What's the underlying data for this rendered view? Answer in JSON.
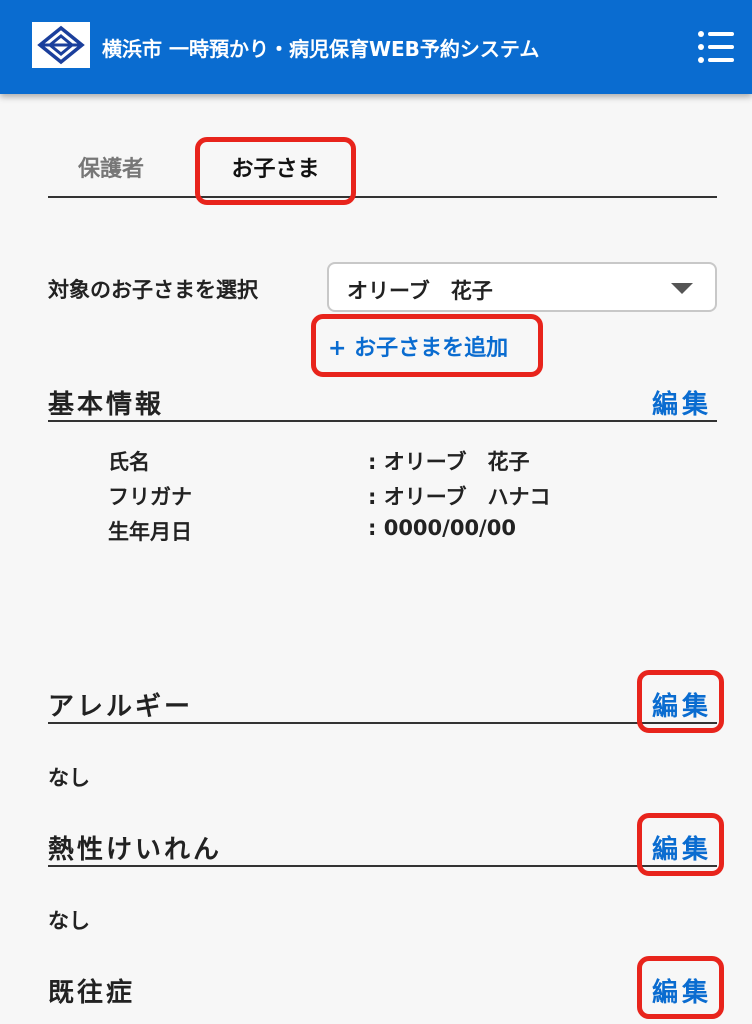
{
  "header": {
    "title": "横浜市 一時預かり・病児保育WEB予約システム",
    "logo_icon": "yokohama-city-emblem",
    "menu_icon": "hamburger-menu-icon",
    "color": "#0a6cd0"
  },
  "tabs": [
    {
      "label": "保護者",
      "selected": false
    },
    {
      "label": "お子さま",
      "selected": true
    }
  ],
  "child_select": {
    "label": "対象のお子さまを選択",
    "value": "オリーブ　花子"
  },
  "add_child": {
    "label": "+ お子さまを追加"
  },
  "sections": {
    "basic": {
      "title": "基本情報",
      "edit": "編集",
      "rows": [
        {
          "key": "氏名",
          "value": ": オリーブ　花子"
        },
        {
          "key": "フリガナ",
          "value": ": オリーブ　ハナコ"
        },
        {
          "key": "生年月日",
          "value": ": 0000/00/00"
        }
      ]
    },
    "allergy": {
      "title": "アレルギー",
      "edit": "編集",
      "value": "なし"
    },
    "febrile": {
      "title": "熱性けいれん",
      "edit": "編集",
      "value": "なし"
    },
    "history": {
      "title": "既往症",
      "edit": "編集"
    }
  },
  "highlight_color": "#e8241c"
}
